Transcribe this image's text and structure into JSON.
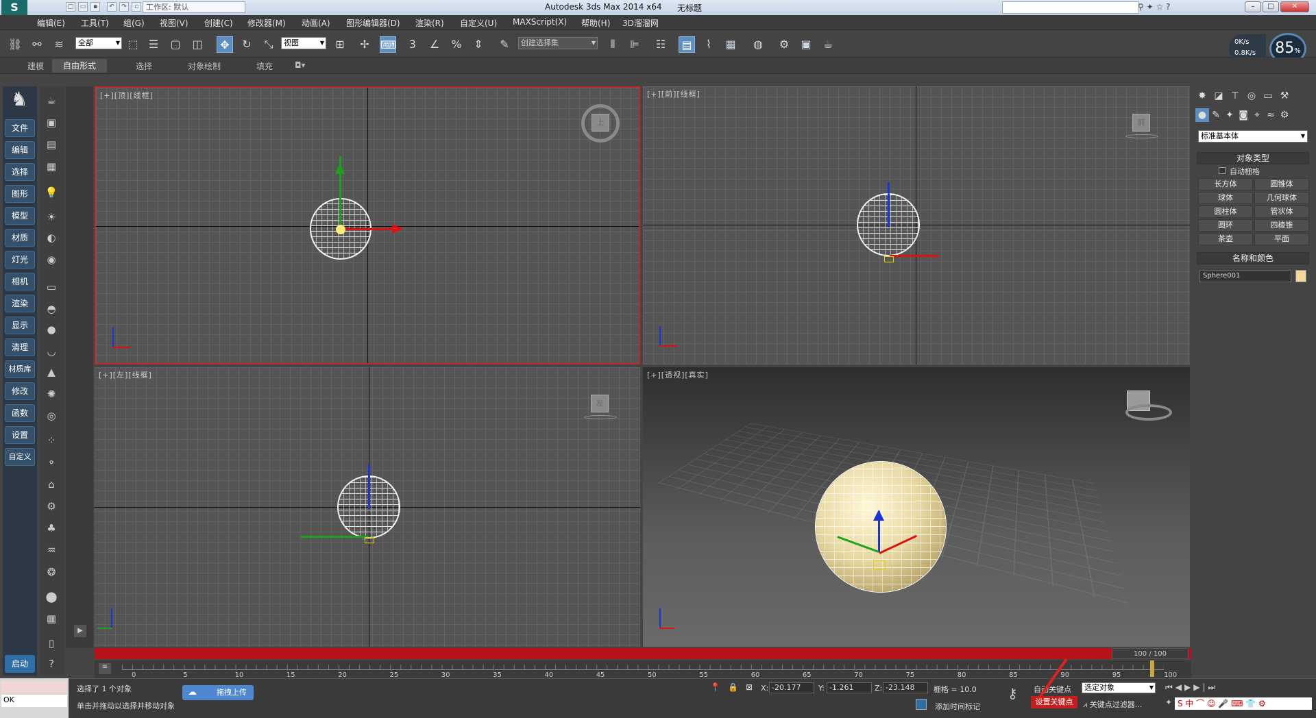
{
  "title_bar": {
    "workspace": "工作区: 默认",
    "app_title": "Autodesk 3ds Max  2014 x64",
    "file_title": "无标题"
  },
  "menu": [
    "编辑(E)",
    "工具(T)",
    "组(G)",
    "视图(V)",
    "创建(C)",
    "修改器(M)",
    "动画(A)",
    "图形编辑器(D)",
    "渲染(R)",
    "自定义(U)",
    "MAXScript(X)",
    "帮助(H)",
    "3D溜溜网"
  ],
  "toolbar": {
    "selection_filter": "全部",
    "reference_coord": "视图",
    "named_selection": "创建选择集",
    "snap_angle": "3",
    "snap_percent": "%"
  },
  "net_speed": {
    "up": "0K/s",
    "down": "0.8K/s"
  },
  "gauge": "85",
  "gauge_unit": "%",
  "ribbon_tabs": [
    "建模",
    "自由形式",
    "选择",
    "对象绘制",
    "填充"
  ],
  "left_commands": [
    "文件",
    "编辑",
    "选择",
    "图形",
    "模型",
    "材质",
    "灯光",
    "相机",
    "渲染",
    "显示",
    "清理",
    "材质库",
    "修改",
    "函数",
    "设置",
    "自定义"
  ],
  "start_button": "启动",
  "viewports": {
    "top": {
      "label": "[+][顶][线框]",
      "cube": "上"
    },
    "front": {
      "label": "[+][前][线框]",
      "cube": "前"
    },
    "left": {
      "label": "[+][左][线框]",
      "cube": "左"
    },
    "perspective": {
      "label": "[+][透视][真实]"
    }
  },
  "command_panel": {
    "category": "标准基本体",
    "object_type_header": "对象类型",
    "autogrid": "自动栅格",
    "objects": [
      "长方体",
      "圆锥体",
      "球体",
      "几何球体",
      "圆柱体",
      "管状体",
      "圆环",
      "四棱锥",
      "茶壶",
      "平面"
    ],
    "name_color_header": "名称和颜色",
    "object_name": "Sphere001",
    "object_color": "#f4d99a"
  },
  "time": {
    "frame_display": "100 / 100",
    "ticks": [
      "0",
      "5",
      "10",
      "15",
      "20",
      "25",
      "30",
      "35",
      "40",
      "45",
      "50",
      "55",
      "60",
      "65",
      "70",
      "75",
      "80",
      "85",
      "90",
      "95",
      "100"
    ]
  },
  "status": {
    "maxscript_value": "OK",
    "selection_msg": "选择了 1 个对象",
    "prompt_msg": "单击并拖动以选择并移动对象",
    "upload_button": "拖拽上传",
    "x_label": "X:",
    "x_value": "-20.177",
    "y_label": "Y:",
    "y_value": "-1.261",
    "z_label": "Z:",
    "z_value": "-23.148",
    "grid": "栅格 = 10.0",
    "auto_key": "自动关键点",
    "set_key": "设置关键点",
    "key_mode": "选定对象",
    "add_time_tag": "添加时间标记",
    "key_filters": "关键点过滤器..."
  }
}
